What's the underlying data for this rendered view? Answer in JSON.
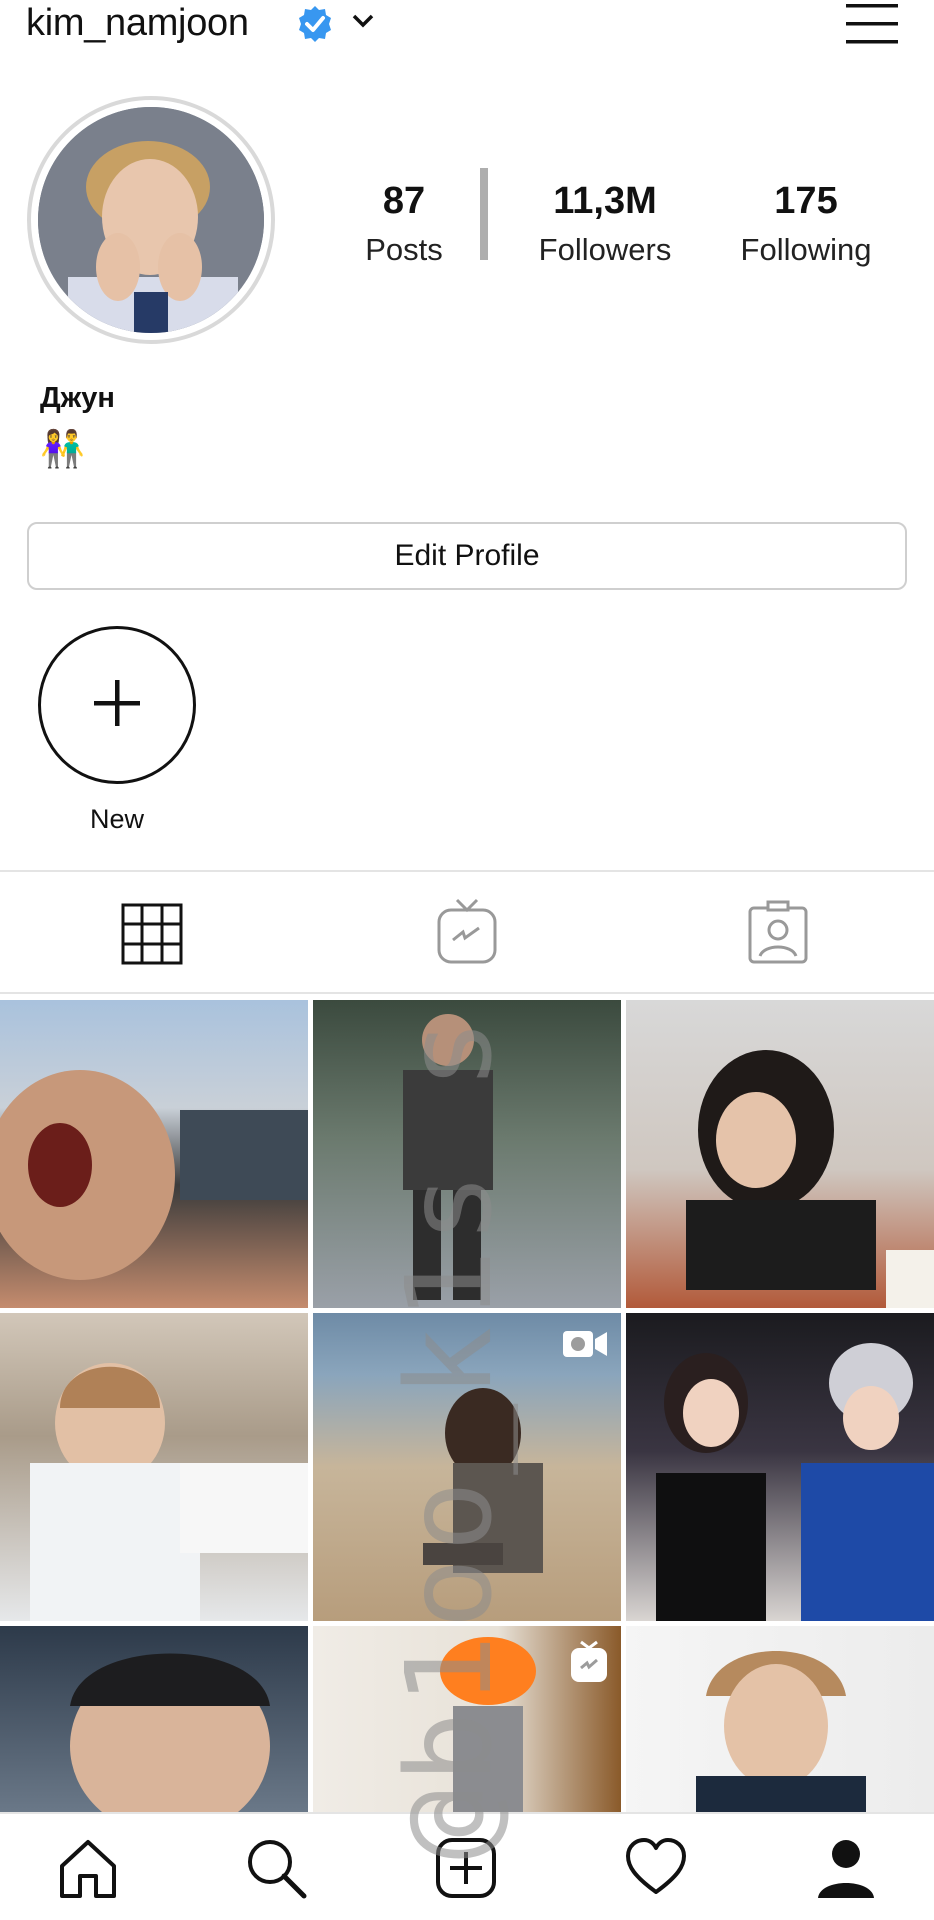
{
  "header": {
    "username": "kim_namjoon",
    "verified_icon": "verified-badge-icon",
    "dropdown_icon": "chevron-down-icon",
    "menu_icon": "hamburger-menu-icon",
    "accent_color": "#3897f0"
  },
  "profile": {
    "avatar_icon": "profile-photo",
    "stats": [
      {
        "value": "87",
        "label": "Posts"
      },
      {
        "value": "11,3M",
        "label": "Followers"
      },
      {
        "value": "175",
        "label": "Following"
      }
    ],
    "display_name": "Джун",
    "bio_emoji": "👫"
  },
  "actions": {
    "edit_profile_label": "Edit Profile"
  },
  "highlights": {
    "new_label": "New",
    "new_icon": "plus-icon"
  },
  "tabs": [
    {
      "name": "grid",
      "icon": "grid-icon"
    },
    {
      "name": "igtv",
      "icon": "igtv-icon"
    },
    {
      "name": "tagged",
      "icon": "tagged-person-icon"
    }
  ],
  "posts": [
    {
      "type": "photo"
    },
    {
      "type": "photo"
    },
    {
      "type": "photo"
    },
    {
      "type": "photo"
    },
    {
      "type": "video",
      "badge_icon": "video-camera-icon"
    },
    {
      "type": "photo"
    },
    {
      "type": "photo"
    },
    {
      "type": "igtv",
      "badge_icon": "igtv-icon"
    },
    {
      "type": "photo"
    }
  ],
  "bottom_nav": [
    {
      "name": "home",
      "icon": "home-icon"
    },
    {
      "name": "search",
      "icon": "search-icon"
    },
    {
      "name": "new-post",
      "icon": "add-post-icon"
    },
    {
      "name": "activity",
      "icon": "heart-icon"
    },
    {
      "name": "profile",
      "icon": "profile-icon"
    }
  ],
  "watermark": "@b1oo_k1s s"
}
